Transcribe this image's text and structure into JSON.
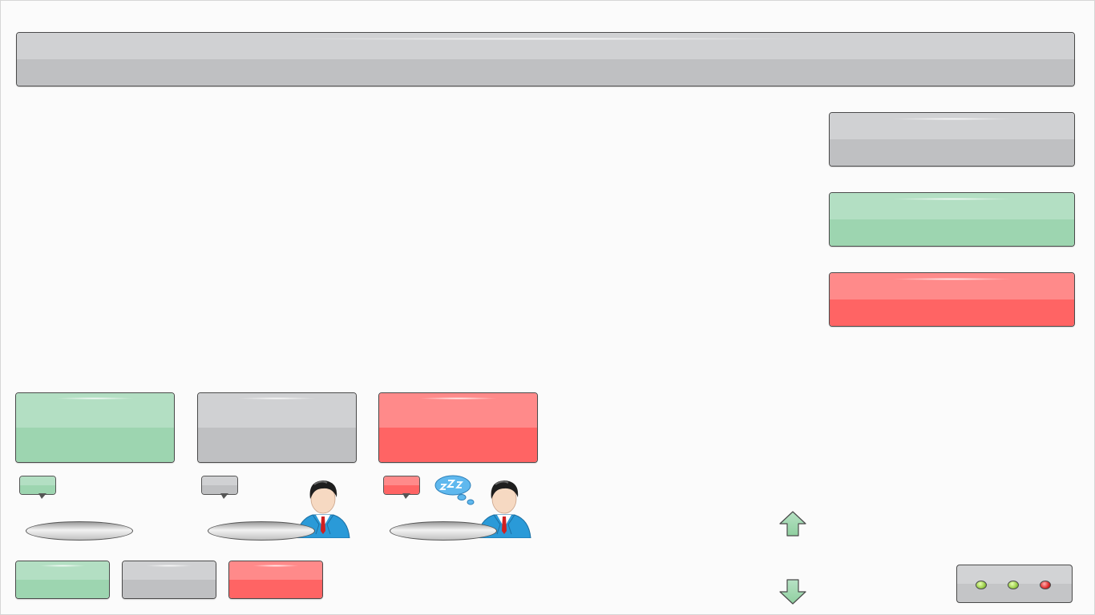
{
  "colors": {
    "gray_top": "#d0d1d3",
    "gray_bottom": "#bfc0c2",
    "green_top": "#b3dfc3",
    "green_bottom": "#9dd5b0",
    "red_top": "#ff8a8a",
    "red_bottom": "#ff6464",
    "border": "#4a4a4a"
  },
  "header": {
    "title": ""
  },
  "side_panels": [
    {
      "name": "status-panel-gray",
      "color": "gray",
      "label": ""
    },
    {
      "name": "status-panel-green",
      "color": "green",
      "label": ""
    },
    {
      "name": "status-panel-red",
      "color": "red",
      "label": ""
    }
  ],
  "stations": [
    {
      "tile_color": "green",
      "bubble_color": "green",
      "person": "none",
      "sleeping": false,
      "label": ""
    },
    {
      "tile_color": "gray",
      "bubble_color": "gray",
      "person": "user-icon",
      "sleeping": false,
      "label": ""
    },
    {
      "tile_color": "red",
      "bubble_color": "red",
      "person": "user-icon",
      "sleeping": true,
      "label": ""
    }
  ],
  "legend_buttons": [
    {
      "color": "green",
      "label": ""
    },
    {
      "color": "gray",
      "label": ""
    },
    {
      "color": "red",
      "label": ""
    }
  ],
  "scroll": {
    "up_icon": "arrow-up-icon",
    "down_icon": "arrow-down-icon"
  },
  "indicator_lights": [
    {
      "name": "led-green-1",
      "color": "#9acd4a"
    },
    {
      "name": "led-green-2",
      "color": "#9acd4a"
    },
    {
      "name": "led-red",
      "color": "#e02a2a"
    }
  ]
}
